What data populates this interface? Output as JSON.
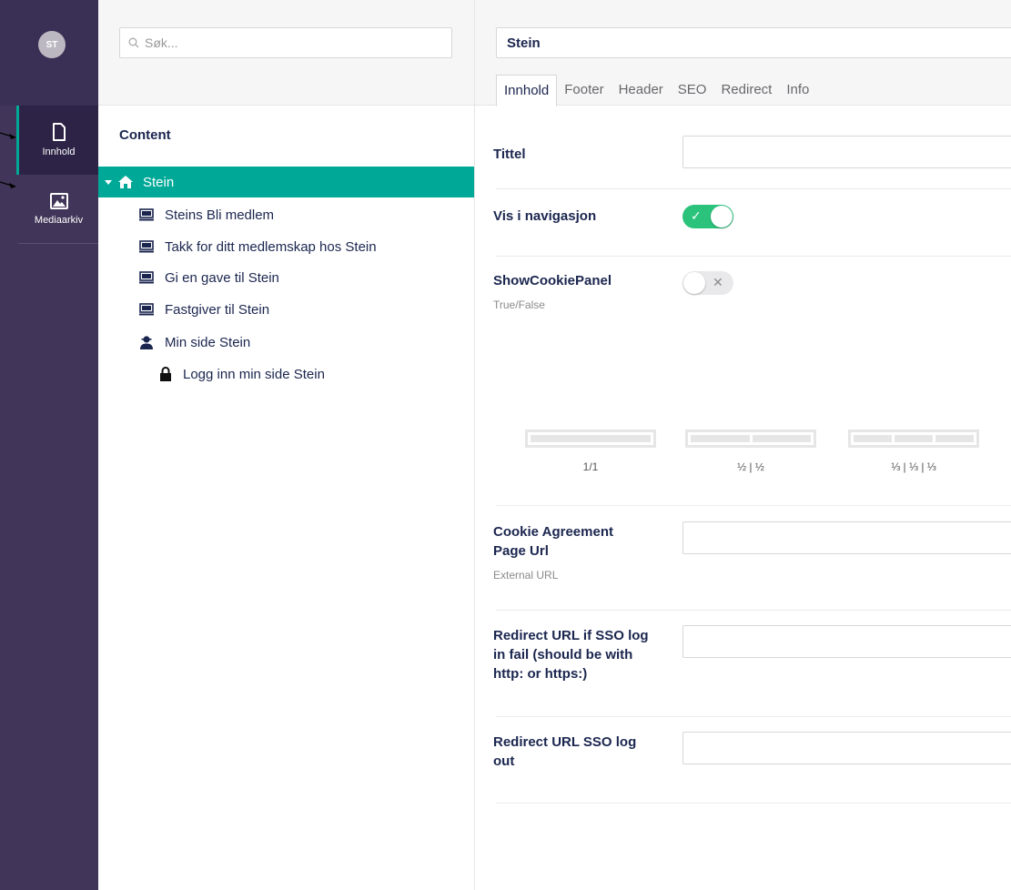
{
  "rail": {
    "avatar_initials": "ST",
    "items": [
      {
        "label": "Innhold",
        "icon": "document-icon",
        "active": true
      },
      {
        "label": "Mediaarkiv",
        "icon": "image-icon",
        "active": false
      }
    ]
  },
  "tree": {
    "search_placeholder": "Søk...",
    "section_title": "Content",
    "root": {
      "label": "Stein",
      "icon": "home-icon",
      "selected": true
    },
    "children": [
      {
        "label": "Steins Bli medlem",
        "icon": "monitor-icon"
      },
      {
        "label": "Takk for ditt medlemskap hos Stein",
        "icon": "monitor-icon"
      },
      {
        "label": "Gi en gave til Stein",
        "icon": "monitor-icon"
      },
      {
        "label": "Fastgiver til Stein",
        "icon": "monitor-icon"
      },
      {
        "label": "Min side Stein",
        "icon": "user-icon"
      },
      {
        "label": "Logg inn min side Stein",
        "icon": "lock-icon"
      }
    ]
  },
  "editor": {
    "name_value": "Stein",
    "tabs": [
      "Innhold",
      "Footer",
      "Header",
      "SEO",
      "Redirect",
      "Info"
    ],
    "active_tab": "Innhold",
    "fields": {
      "tittel": {
        "label": "Tittel",
        "value": ""
      },
      "vis_i_navigasjon": {
        "label": "Vis i navigasjon",
        "checked": true
      },
      "show_cookie_panel": {
        "label": "ShowCookiePanel",
        "description": "True/False",
        "checked": false
      },
      "cookie_agreement": {
        "label": "Cookie Agreement Page Url",
        "description": "External URL",
        "value": ""
      },
      "redirect_sso_fail": {
        "label": "Redirect URL if SSO log in fail (should be with http: or https:)",
        "value": ""
      },
      "redirect_sso_logout": {
        "label": "Redirect URL SSO log out",
        "value": ""
      }
    },
    "layouts": [
      {
        "caption": "1/1",
        "columns": 1
      },
      {
        "caption": "½ | ½",
        "columns": 2
      },
      {
        "caption": "⅓ | ⅓ | ⅓",
        "columns": 3
      }
    ]
  },
  "colors": {
    "rail": "#413659",
    "accent": "#00a997",
    "toggle_on": "#2bc37c",
    "text": "#1b264f"
  }
}
